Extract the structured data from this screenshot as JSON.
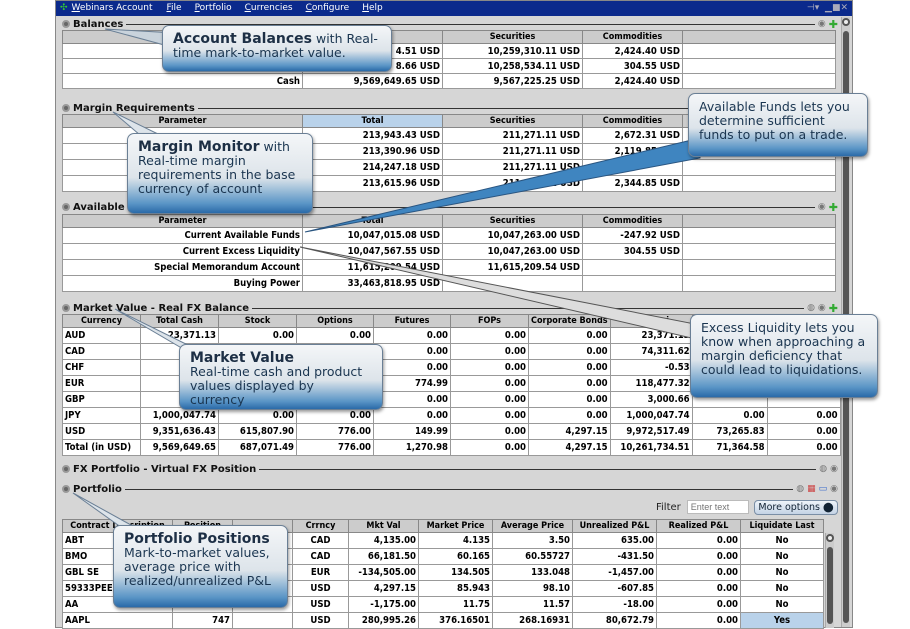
{
  "window": {
    "title": "Webinars Account",
    "menu": [
      "File",
      "Portfolio",
      "Currencies",
      "Configure",
      "Help"
    ]
  },
  "balances": {
    "title": "Balances",
    "headers": [
      "",
      "",
      "Securities",
      "Commodities",
      ""
    ],
    "rows": [
      [
        "",
        "4.51 USD",
        "10,259,310.11 USD",
        "2,424.40 USD",
        ""
      ],
      [
        "",
        "8.66 USD",
        "10,258,534.11 USD",
        "304.55 USD",
        ""
      ],
      [
        "Cash",
        "9,569,649.65 USD",
        "9,567,225.25 USD",
        "2,424.40 USD",
        ""
      ]
    ]
  },
  "margin": {
    "title": "Margin Requirements",
    "headers": [
      "Parameter",
      "Total",
      "Securities",
      "Commodities",
      ""
    ],
    "rows": [
      [
        "",
        "213,943.43 USD",
        "211,271.11 USD",
        "2,672.31 USD",
        ""
      ],
      [
        "",
        "213,390.96 USD",
        "211,271.11 USD",
        "2,119.85 USD",
        ""
      ],
      [
        "",
        "214,247.18 USD",
        "211,271.11 USD",
        "",
        ""
      ],
      [
        "",
        "213,615.96 USD",
        "211,271.11 USD",
        "2,344.85 USD",
        ""
      ]
    ]
  },
  "available": {
    "title": "Available",
    "headers": [
      "Parameter",
      "Total",
      "Securities",
      "Commodities",
      ""
    ],
    "rows": [
      [
        "Current Available Funds",
        "10,047,015.08 USD",
        "10,047,263.00 USD",
        "-247.92 USD",
        ""
      ],
      [
        "Current Excess Liquidity",
        "10,047,567.55 USD",
        "10,047,263.00 USD",
        "304.55 USD",
        ""
      ],
      [
        "Special Memorandum Account",
        "11,615,209.54 USD",
        "11,615,209.54 USD",
        "",
        ""
      ],
      [
        "Buying Power",
        "33,463,818.95 USD",
        "",
        "",
        ""
      ]
    ]
  },
  "market": {
    "title": "Market Value - Real FX Balance",
    "headers": [
      "Currency",
      "Total Cash",
      "Stock",
      "Options",
      "Futures",
      "FOPs",
      "Corporate Bonds",
      "Nt Liqui",
      "",
      ""
    ],
    "rows": [
      [
        "AUD",
        "23,371.13",
        "0.00",
        "0.00",
        "0.00",
        "0.00",
        "0.00",
        "23,371.13",
        "",
        ""
      ],
      [
        "CAD",
        "",
        "",
        "",
        "0.00",
        "0.00",
        "0.00",
        "74,311.62",
        "",
        ""
      ],
      [
        "CHF",
        "",
        "",
        "",
        "0.00",
        "0.00",
        "0.00",
        "-0.53",
        "",
        ""
      ],
      [
        "EUR",
        "118,",
        "",
        "",
        "774.99",
        "0.00",
        "0.00",
        "118,477.32",
        "",
        ""
      ],
      [
        "GBP",
        "3,",
        "",
        "",
        "0.00",
        "0.00",
        "0.00",
        "3,000.66",
        "",
        ""
      ],
      [
        "JPY",
        "1,000,047.74",
        "0.00",
        "0.00",
        "0.00",
        "0.00",
        "0.00",
        "1,000,047.74",
        "0.00",
        "0.00"
      ],
      [
        "USD",
        "9,351,636.43",
        "615,807.90",
        "776.00",
        "149.99",
        "0.00",
        "4,297.15",
        "9,972,517.49",
        "73,265.83",
        "0.00"
      ],
      [
        "Total (in USD)",
        "9,569,649.65",
        "687,071.49",
        "776.00",
        "1,270.98",
        "0.00",
        "4,297.15",
        "10,261,734.51",
        "71,364.58",
        "0.00"
      ]
    ]
  },
  "fx": {
    "title": "FX Portfolio - Virtual FX Position"
  },
  "portfolio": {
    "title": "Portfolio",
    "filter_label": "Filter",
    "filter_placeholder": "Enter text",
    "more_options": "More options",
    "headers": [
      "Contract Description",
      "Position",
      "",
      "Crrncy",
      "Mkt Val",
      "Market Price",
      "Average Price",
      "Unrealized P&L",
      "Realized P&L",
      "Liquidate Last"
    ],
    "rows": [
      [
        "ABT",
        "",
        "",
        "CAD",
        "4,135.00",
        "4.135",
        "3.50",
        "635.00",
        "0.00",
        "No"
      ],
      [
        "BMO",
        "",
        "",
        "CAD",
        "66,181.50",
        "60.165",
        "60.55727",
        "-431.50",
        "0.00",
        "No"
      ],
      [
        "GBL     SE",
        "",
        "",
        "EUR",
        "-134,505.00",
        "134.505",
        "133.048",
        "-1,457.00",
        "0.00",
        "No"
      ],
      [
        "59333PEE4",
        "",
        "",
        "USD",
        "4,297.15",
        "85.943",
        "98.10",
        "-607.85",
        "0.00",
        "No"
      ],
      [
        "AA",
        "",
        "",
        "USD",
        "-1,175.00",
        "11.75",
        "11.57",
        "-18.00",
        "0.00",
        "No"
      ],
      [
        "AAPL",
        "747",
        "",
        "USD",
        "280,995.26",
        "376.16501",
        "268.16931",
        "80,672.79",
        "0.00",
        "Yes"
      ]
    ]
  },
  "callouts": {
    "balances": {
      "title": "Account Balances",
      "text": " with Real-time mark-to-market value."
    },
    "margin": {
      "title": "Margin Monitor",
      "text": " with Real-time margin requirements in the base currency of account"
    },
    "funds": {
      "text": "Available Funds lets you determine sufficient funds to put on a trade."
    },
    "market": {
      "title": "Market Value",
      "text": "Real-time cash and product values displayed by currency"
    },
    "liquidity": {
      "text": "Excess Liquidity lets you know when approaching a margin deficiency that could lead to liquidations."
    },
    "portfolio": {
      "title": "Portfolio Positions",
      "text": "Mark-to-market values, average price with realized/unrealized P&L"
    }
  },
  "colors": {
    "titlebar": "#0b2a8c",
    "highlight": "#b9d2ea",
    "callout": "#2a6aa8"
  }
}
